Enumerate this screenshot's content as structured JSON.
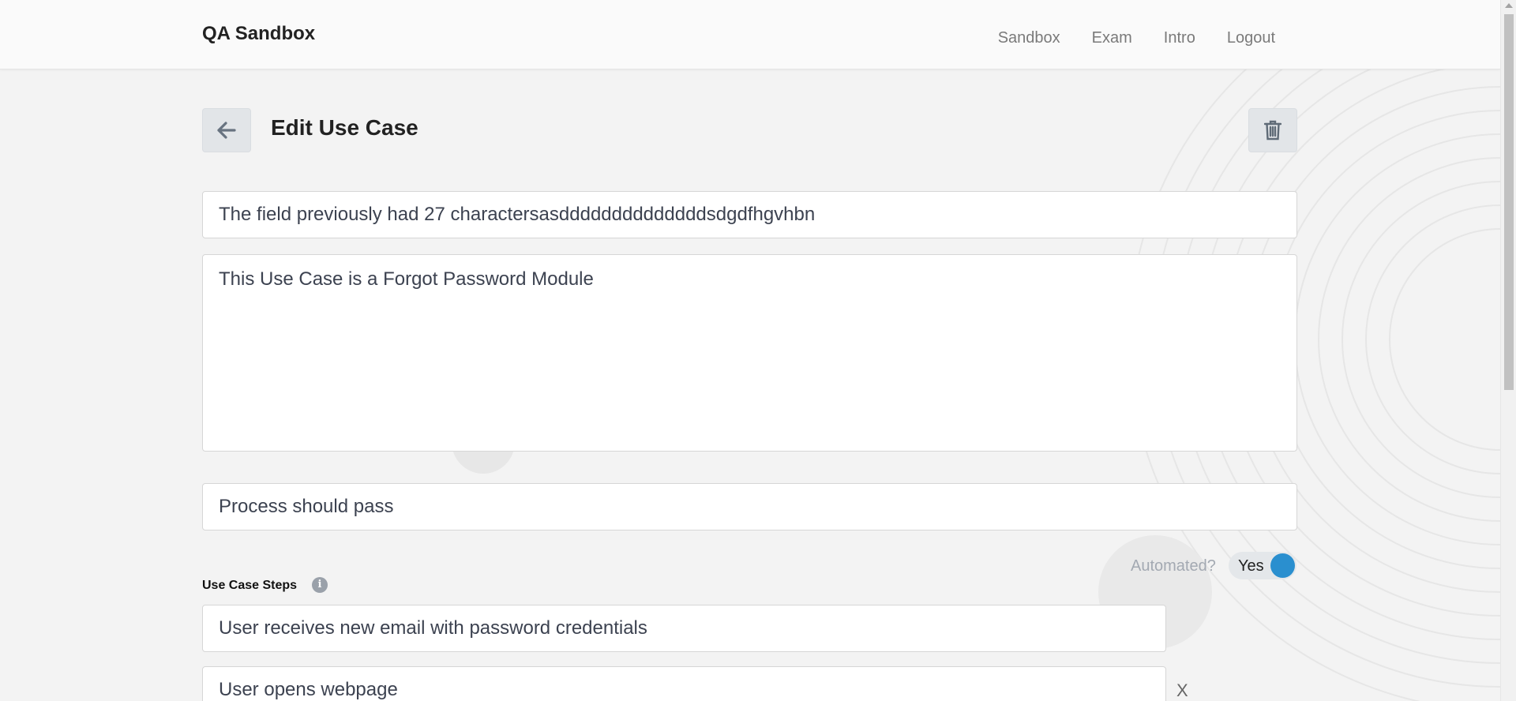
{
  "navbar": {
    "brand": "QA Sandbox",
    "links": [
      "Sandbox",
      "Exam",
      "Intro",
      "Logout"
    ]
  },
  "header": {
    "title": "Edit Use Case",
    "back_icon": "arrow-left-icon",
    "delete_icon": "trash-icon"
  },
  "form": {
    "title_value": "The field previously had 27 charactersasddddddddddddddsdgdfhgvhbn",
    "description_value": "This Use Case is a Forgot Password Module",
    "expected_result_value": "Process should pass",
    "automated": {
      "label": "Automated?",
      "state": "Yes"
    },
    "steps": {
      "label": "Use Case Steps",
      "info_glyph": "i",
      "items": [
        "User receives new email with password credentials",
        "User opens webpage"
      ],
      "remove_label": "X"
    }
  },
  "colors": {
    "toggle_accent": "#2a8fcf",
    "background": "#f3f3f3"
  }
}
